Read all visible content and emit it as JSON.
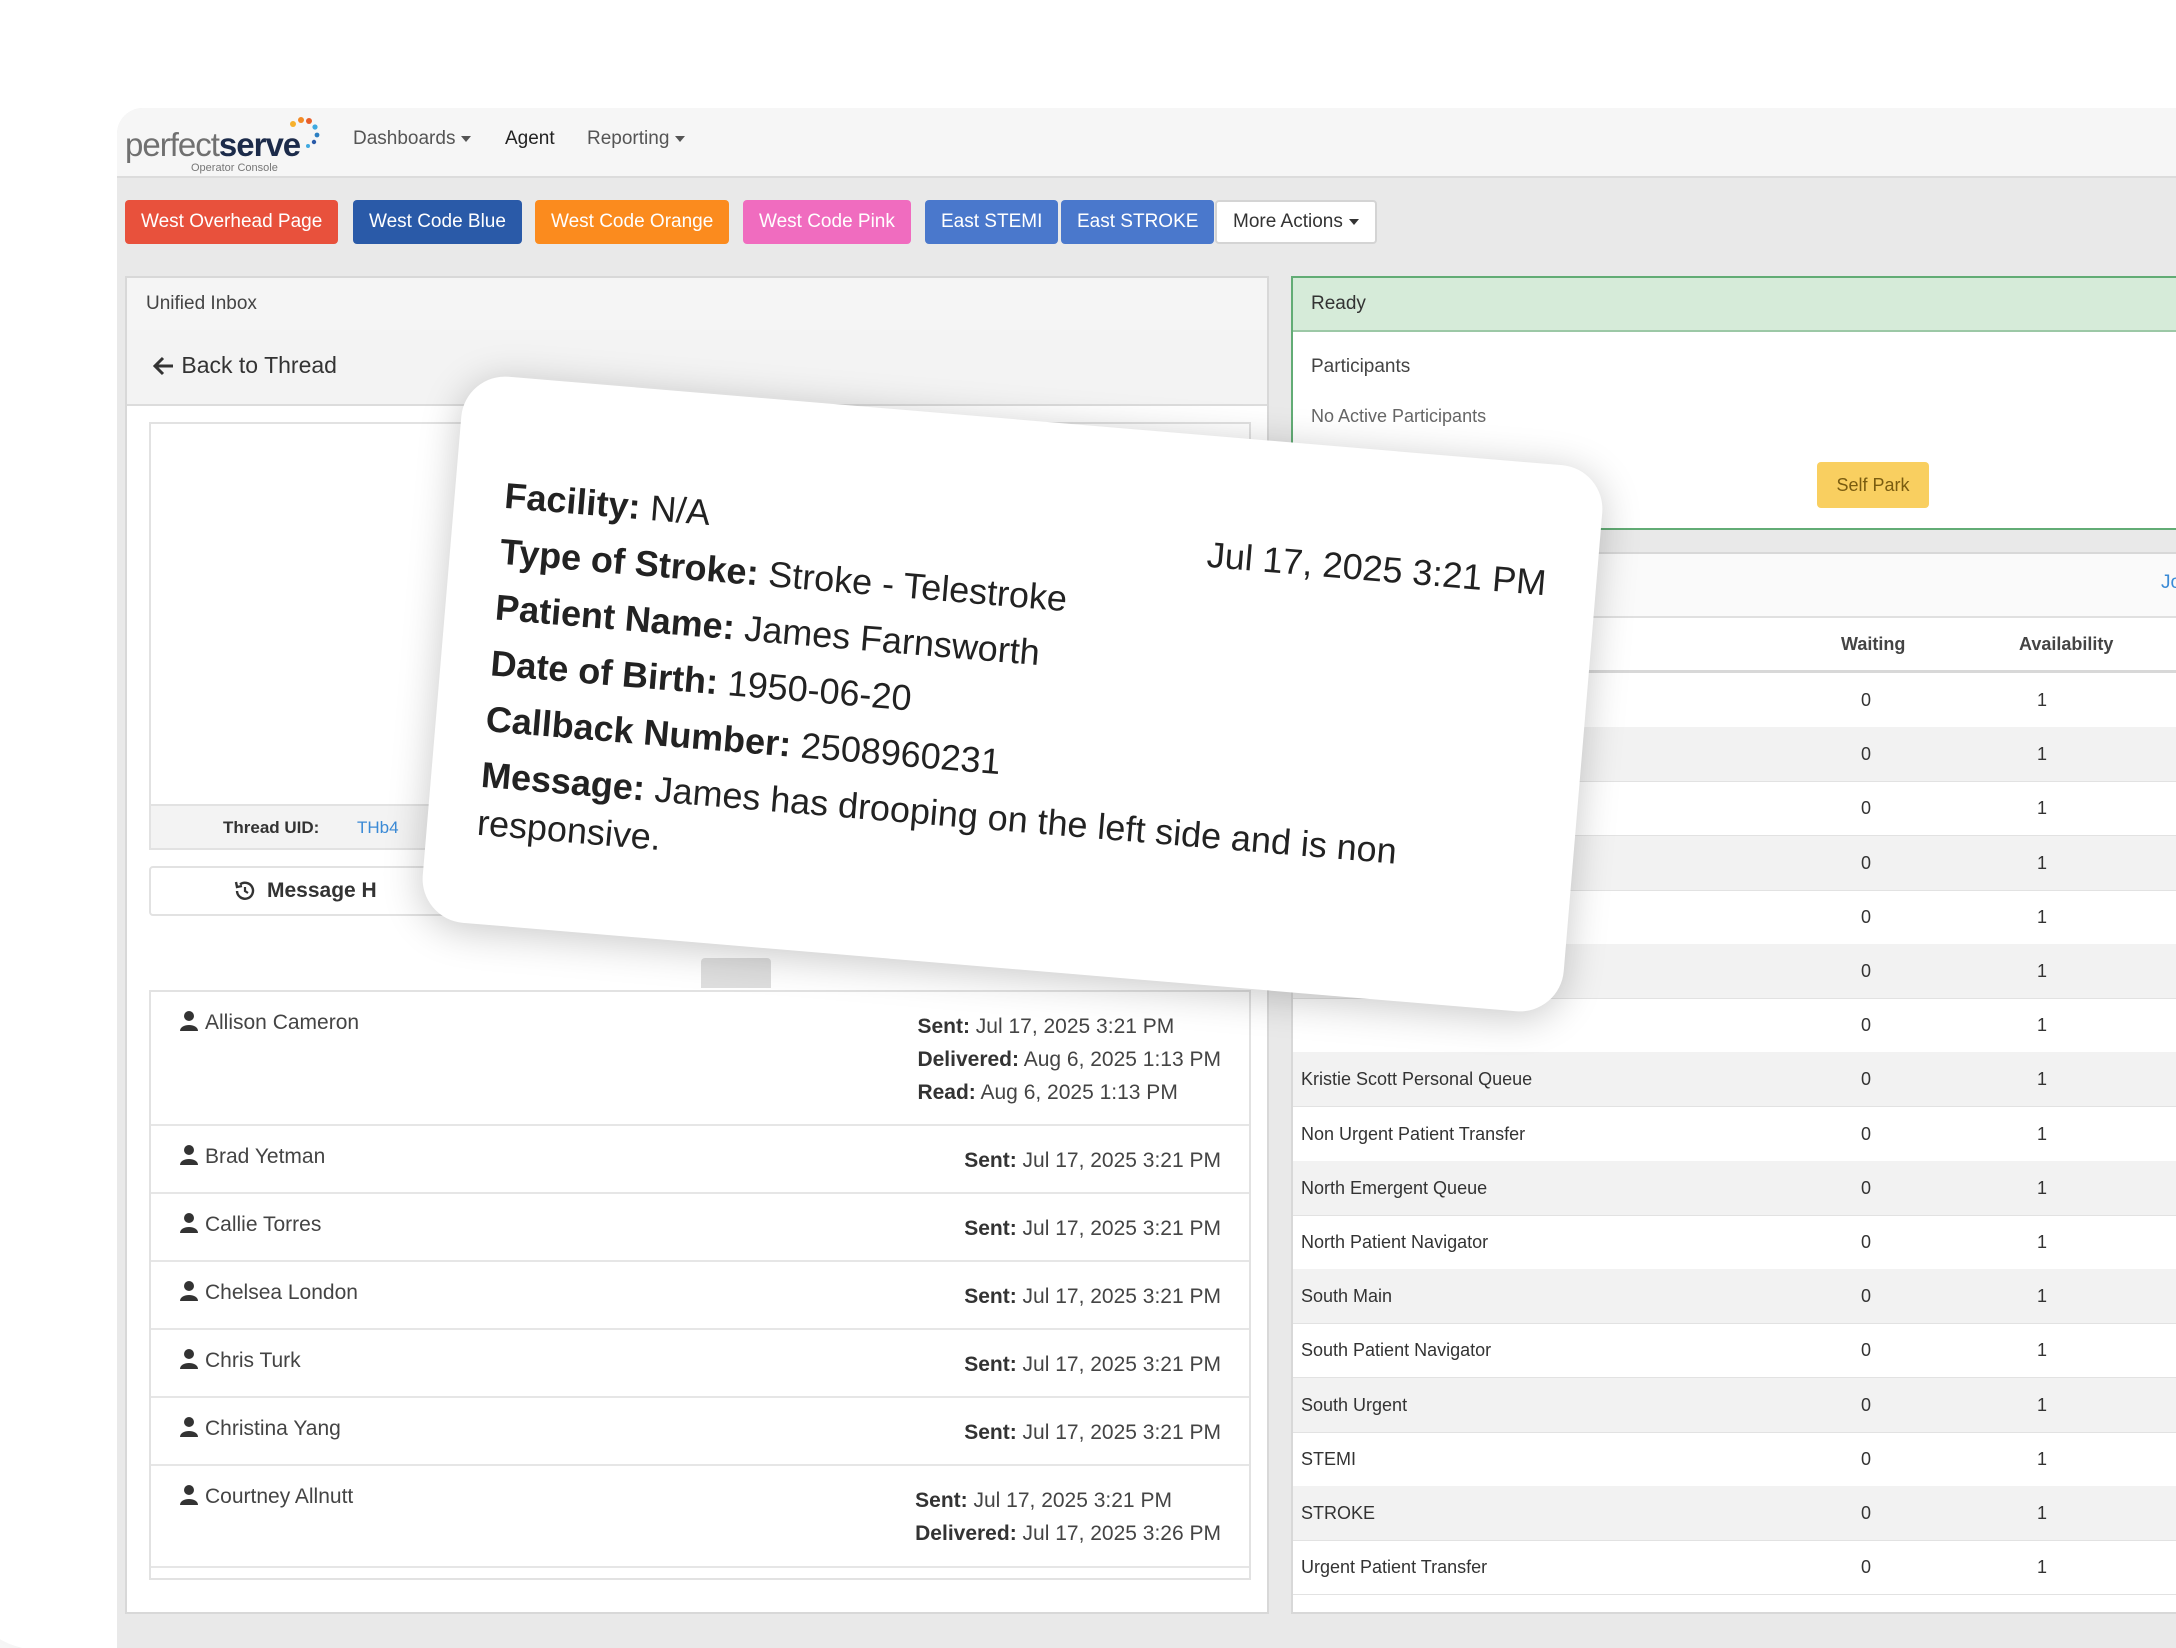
{
  "header": {
    "logo": {
      "part1": "perfect",
      "part2": "serve",
      "subtitle": "Operator Console"
    },
    "nav": [
      {
        "label": "Dashboards",
        "dropdown": true
      },
      {
        "label": "Agent",
        "dropdown": false
      },
      {
        "label": "Reporting",
        "dropdown": true
      }
    ]
  },
  "actions": [
    {
      "label": "West Overhead Page",
      "color": "#e8513c"
    },
    {
      "label": "West Code Blue",
      "color": "#2a5aa8"
    },
    {
      "label": "West Code Orange",
      "color": "#fb8b1e"
    },
    {
      "label": "West Code Pink",
      "color": "#f06cbf"
    },
    {
      "label": "East STEMI",
      "color": "#4a78cc"
    },
    {
      "label": "East STROKE",
      "color": "#4a78cc"
    },
    {
      "label": "More Actions",
      "color": "#ffffff"
    }
  ],
  "inbox": {
    "title": "Unified Inbox",
    "back_label": "Back to Thread",
    "thread_uid_label": "Thread UID:",
    "thread_uid_value": "THb4",
    "message_history_label": "Message H",
    "recipients": [
      {
        "name": "Allison Cameron",
        "sent": "Jul 17, 2025 3:21 PM",
        "delivered": "Aug 6, 2025 1:13 PM",
        "read": "Aug 6, 2025 1:13 PM"
      },
      {
        "name": "Brad Yetman",
        "sent": "Jul 17, 2025 3:21 PM"
      },
      {
        "name": "Callie Torres",
        "sent": "Jul 17, 2025 3:21 PM"
      },
      {
        "name": "Chelsea London",
        "sent": "Jul 17, 2025 3:21 PM"
      },
      {
        "name": "Chris Turk",
        "sent": "Jul 17, 2025 3:21 PM"
      },
      {
        "name": "Christina Yang",
        "sent": "Jul 17, 2025 3:21 PM"
      },
      {
        "name": "Courtney Allnutt",
        "sent": "Jul 17, 2025 3:21 PM",
        "delivered": "Jul 17, 2025 3:26 PM"
      }
    ],
    "labels": {
      "sent": "Sent:",
      "delivered": "Delivered:",
      "read": "Read:"
    }
  },
  "status": {
    "title": "Ready",
    "participants_label": "Participants",
    "participants_value": "No Active Participants",
    "self_park_label": "Self Park"
  },
  "queues": {
    "top_link": "Jo",
    "columns": {
      "waiting": "Waiting",
      "availability": "Availability"
    },
    "rows": [
      {
        "name": "",
        "waiting": "0",
        "availability": "1"
      },
      {
        "name": "",
        "waiting": "0",
        "availability": "1"
      },
      {
        "name": "",
        "waiting": "0",
        "availability": "1"
      },
      {
        "name": "",
        "waiting": "0",
        "availability": "1"
      },
      {
        "name": "",
        "waiting": "0",
        "availability": "1"
      },
      {
        "name": "",
        "waiting": "0",
        "availability": "1"
      },
      {
        "name": "",
        "waiting": "0",
        "availability": "1"
      },
      {
        "name": "Kristie Scott Personal Queue",
        "waiting": "0",
        "availability": "1"
      },
      {
        "name": "Non Urgent Patient Transfer",
        "waiting": "0",
        "availability": "1"
      },
      {
        "name": "North Emergent Queue",
        "waiting": "0",
        "availability": "1"
      },
      {
        "name": "North Patient Navigator",
        "waiting": "0",
        "availability": "1"
      },
      {
        "name": "South Main",
        "waiting": "0",
        "availability": "1"
      },
      {
        "name": "South Patient Navigator",
        "waiting": "0",
        "availability": "1"
      },
      {
        "name": "South Urgent",
        "waiting": "0",
        "availability": "1"
      },
      {
        "name": "STEMI",
        "waiting": "0",
        "availability": "1"
      },
      {
        "name": "STROKE",
        "waiting": "0",
        "availability": "1"
      },
      {
        "name": "Urgent Patient Transfer",
        "waiting": "0",
        "availability": "1"
      }
    ]
  },
  "popup": {
    "timestamp": "Jul 17, 2025 3:21 PM",
    "fields": [
      {
        "label": "Facility:",
        "value": " N/A"
      },
      {
        "label": "Type of Stroke:",
        "value": " Stroke - Telestroke"
      },
      {
        "label": "Patient Name:",
        "value": " James Farnsworth"
      },
      {
        "label": "Date of Birth:",
        "value": " 1950-06-20"
      },
      {
        "label": "Callback Number:",
        "value": " 2508960231"
      },
      {
        "label": "Message:",
        "value": " James has drooping on the left side and is non"
      }
    ],
    "message_continuation": "responsive."
  }
}
